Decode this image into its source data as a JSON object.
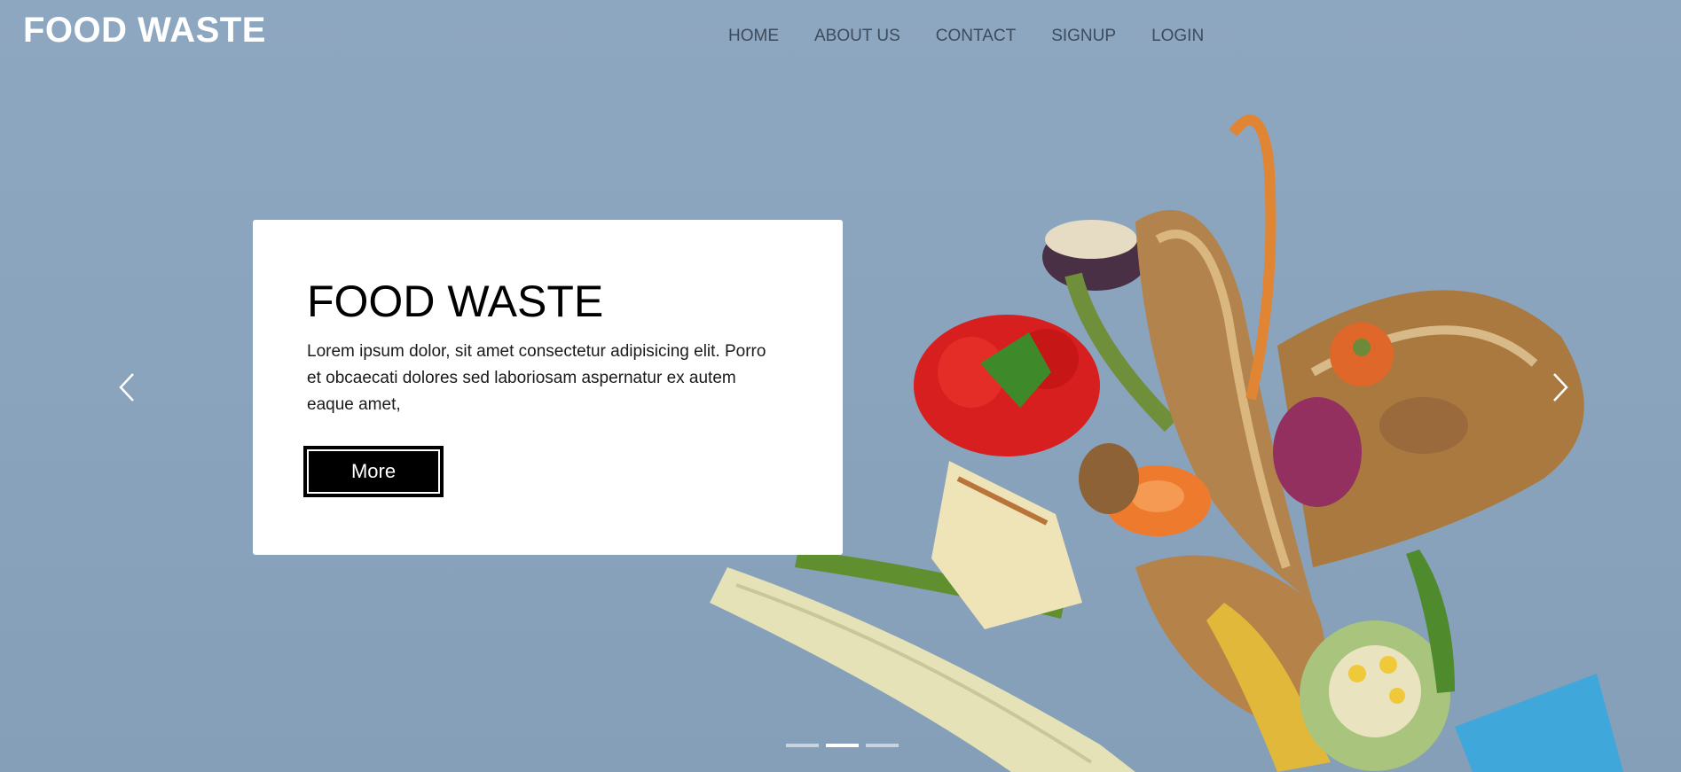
{
  "header": {
    "brand": "FOOD WASTE",
    "nav": [
      "HOME",
      "ABOUT US",
      "CONTACT",
      "SIGNUP",
      "LOGIN"
    ]
  },
  "hero": {
    "title": "FOOD WASTE",
    "body": "Lorem ipsum dolor, sit amet consectetur adipisicing elit. Porro et obcaecati dolores sed laboriosam aspernatur ex autem eaque amet,",
    "button_label": "More"
  },
  "carousel": {
    "prev_icon": "chevron-left-icon",
    "next_icon": "chevron-right-icon",
    "slides": 3,
    "active_index": 1
  },
  "colors": {
    "background": "#8ea7c1",
    "card": "#ffffff",
    "button": "#000000",
    "nav_text": "#3d4b5c"
  }
}
